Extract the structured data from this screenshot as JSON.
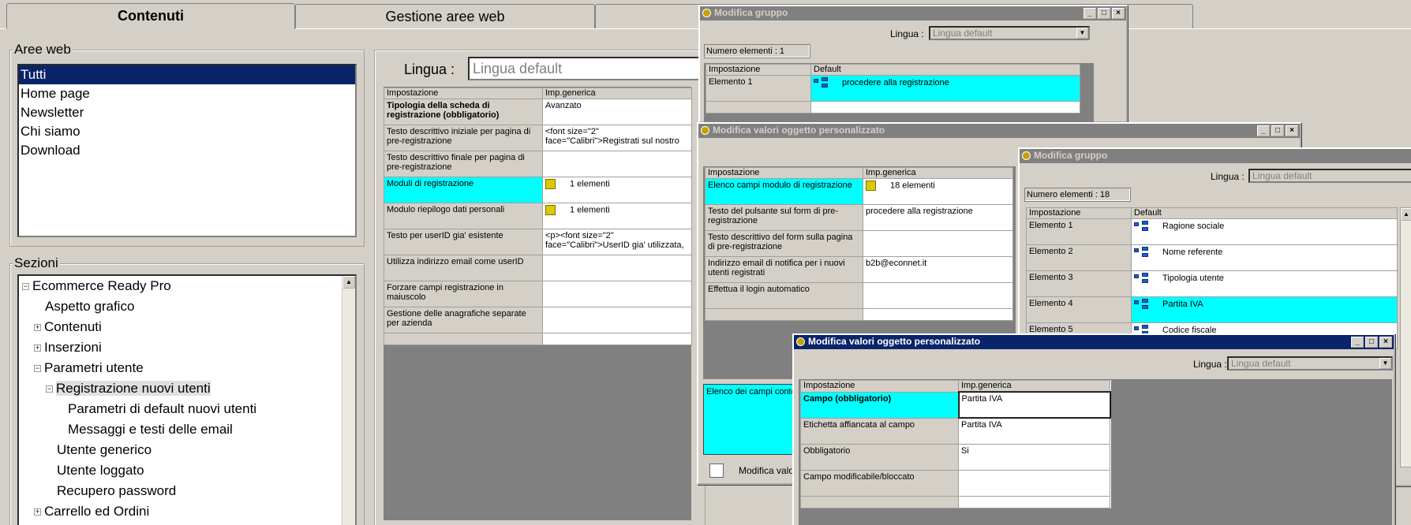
{
  "tabs": [
    "Contenuti",
    "Gestione aree web",
    ""
  ],
  "aree_web": {
    "legend": "Aree web",
    "items": [
      "Tutti",
      "Home page",
      "Newsletter",
      "Chi siamo",
      "Download"
    ],
    "selected": 0
  },
  "sezioni": {
    "legend": "Sezioni",
    "nodes": [
      "Ecommerce Ready Pro",
      "Aspetto grafico",
      "Contenuti",
      "Inserzioni",
      "Parametri utente",
      "Registrazione nuovi utenti",
      "Parametri di default nuovi utenti",
      "Messaggi e testi delle email",
      "Utente generico",
      "Utente loggato",
      "Recupero password",
      "Carrello ed Ordini"
    ]
  },
  "main": {
    "lingua_label": "Lingua :",
    "lingua_value": "Lingua default",
    "grid_headers": [
      "Impostazione",
      "Imp.generica"
    ],
    "rows": [
      {
        "k": "Tipologia della scheda di registrazione (obbligatorio)",
        "v": "Avanzato"
      },
      {
        "k": "Testo descrittivo iniziale per pagina di pre-registrazione",
        "v": "<font size=\"2\" face=\"Calibri\">Registrati sul nostro"
      },
      {
        "k": "Testo descrittivo finale per pagina di pre-registrazione",
        "v": ""
      },
      {
        "k": "Moduli di registrazione",
        "v": "1 elementi"
      },
      {
        "k": "Modulo riepilogo dati personali",
        "v": "1 elementi"
      },
      {
        "k": "Testo per userID gia' esistente",
        "v": "<p><font size=\"2\" face=\"Calibri\">UserID gia' utilizzata,"
      },
      {
        "k": "Utilizza indirizzo email come userID",
        "v": ""
      },
      {
        "k": "Forzare campi registrazione in maiuscolo",
        "v": ""
      },
      {
        "k": "Gestione delle anagrafiche separate per azienda",
        "v": ""
      }
    ]
  },
  "win1": {
    "title": "Modifica gruppo",
    "lingua_label": "Lingua :",
    "lingua_value": "Lingua default",
    "count": "Numero elementi : 1",
    "headers": [
      "Impostazione",
      "Default"
    ],
    "rows": [
      {
        "k": "Elemento 1",
        "v": "procedere alla registrazione"
      }
    ]
  },
  "win2": {
    "title": "Modifica valori oggetto personalizzato",
    "headers": [
      "Impostazione",
      "Imp.generica"
    ],
    "rows": [
      {
        "k": "Elenco campi modulo di registrazione",
        "v": "18 elementi"
      },
      {
        "k": "Testo del pulsante sul form di pre-registrazione",
        "v": "procedere alla registrazione"
      },
      {
        "k": "Testo descrittivo del form sulla pagina di pre-registrazione",
        "v": ""
      },
      {
        "k": "Indirizzo email di notifica per i nuovi utenti registrati",
        "v": "b2b@econnet.it"
      },
      {
        "k": "Effettua il login automatico",
        "v": ""
      }
    ],
    "desc": "Elenco dei campi conte",
    "edit_button": "Modifica valor"
  },
  "win3": {
    "title": "Modifica gruppo",
    "lingua_label": "Lingua :",
    "lingua_value": "Lingua default",
    "count": "Numero elementi : 18",
    "headers": [
      "Impostazione",
      "Default"
    ],
    "rows": [
      {
        "k": "Elemento 1",
        "v": "Ragione sociale"
      },
      {
        "k": "Elemento 2",
        "v": "Nome referente"
      },
      {
        "k": "Elemento 3",
        "v": "Tipologia utente"
      },
      {
        "k": "Elemento 4",
        "v": "Partita IVA"
      },
      {
        "k": "Elemento 5",
        "v": "Codice fiscale"
      }
    ]
  },
  "win4": {
    "title": "Modifica valori oggetto personalizzato",
    "lingua_label": "Lingua :",
    "lingua_value": "Lingua default",
    "headers": [
      "Impostazione",
      "Imp.generica"
    ],
    "rows": [
      {
        "k": "Campo (obbligatorio)",
        "v": "Partita IVA"
      },
      {
        "k": "Etichetta affiancata al campo",
        "v": "Partita IVA"
      },
      {
        "k": "Obbligatorio",
        "v": "Si"
      },
      {
        "k": "Campo modificabile/bloccato",
        "v": ""
      }
    ]
  }
}
